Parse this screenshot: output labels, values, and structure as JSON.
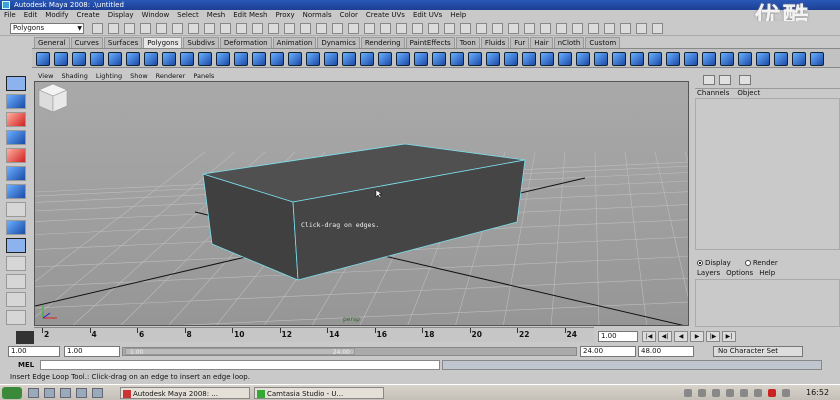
{
  "window": {
    "title": "Autodesk Maya 2008: .\\untitled"
  },
  "watermark": "优酷",
  "menubar": [
    "File",
    "Edit",
    "Modify",
    "Create",
    "Display",
    "Window",
    "Select",
    "Mesh",
    "Edit Mesh",
    "Proxy",
    "Normals",
    "Color",
    "Create UVs",
    "Edit UVs",
    "Help"
  ],
  "statusline": {
    "mode": "Polygons"
  },
  "shelf_tabs": [
    "General",
    "Curves",
    "Surfaces",
    "Polygons",
    "Subdivs",
    "Deformation",
    "Animation",
    "Dynamics",
    "Rendering",
    "PaintEffects",
    "Toon",
    "Fluids",
    "Fur",
    "Hair",
    "nCloth",
    "Custom"
  ],
  "active_shelf": "Polygons",
  "panel_menu": [
    "View",
    "Shading",
    "Lighting",
    "Show",
    "Renderer",
    "Panels"
  ],
  "viewport": {
    "tooltip": "Click-drag on edges.",
    "camera": "persp"
  },
  "channel_box": {
    "menu": [
      "Channels",
      "Object"
    ]
  },
  "layer_editor": {
    "display_label": "Display",
    "render_label": "Render",
    "menu": [
      "Layers",
      "Options",
      "Help"
    ],
    "selected": "Display"
  },
  "time_slider": {
    "ticks": [
      "2",
      "4",
      "6",
      "8",
      "10",
      "12",
      "14",
      "16",
      "18",
      "20",
      "22",
      "24"
    ],
    "current_time": "1.00"
  },
  "range_slider": {
    "start_time": "1.00",
    "playback_start": "1.00",
    "handle_start": "1.00",
    "handle_end": "24.00",
    "playback_end": "24.00",
    "end_time": "48.00",
    "character_set": "No Character Set"
  },
  "command_line": {
    "label": "MEL"
  },
  "help_line": "Insert Edge Loop Tool.: Click-drag on an edge to insert an edge loop.",
  "taskbar": {
    "tasks": [
      "Autodesk Maya 2008: ...",
      "Camtasia Studio - U..."
    ],
    "clock": "16:52"
  }
}
